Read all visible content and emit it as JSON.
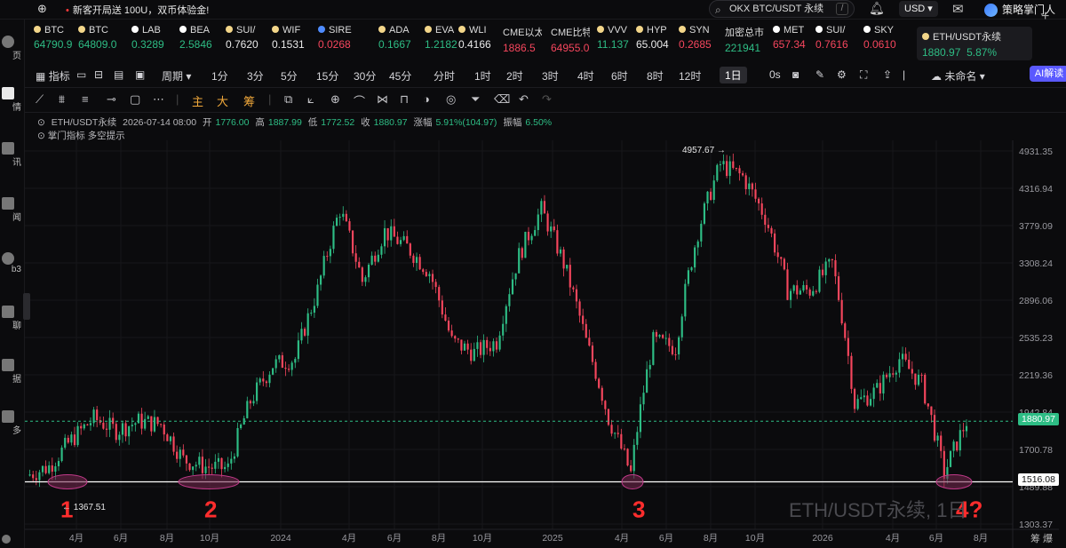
{
  "topbar": {
    "promo": "新客开局送 100U，双币体验金!",
    "search_value": "OKX BTC/USDT 永续",
    "search_shortcut": "/",
    "currency": "USD",
    "brand": "策略掌门人"
  },
  "leftnav": {
    "items": [
      {
        "label": "页"
      },
      {
        "label": "情"
      },
      {
        "label": "讯"
      },
      {
        "label": "闻"
      },
      {
        "label": "b3"
      },
      {
        "label": "聊"
      },
      {
        "label": "据"
      },
      {
        "label": "多"
      }
    ]
  },
  "tickers": [
    {
      "name": "BTC",
      "price": "64790.9",
      "dir": "up",
      "icon_color": "#f3d68a"
    },
    {
      "name": "BTC",
      "price": "64809.0",
      "dir": "up",
      "icon_color": "#f3d68a"
    },
    {
      "name": "LAB",
      "price": "0.3289",
      "dir": "up",
      "icon_color": "#ffffff"
    },
    {
      "name": "BEA",
      "price": "2.5846",
      "dir": "up",
      "icon_color": "#ffffff"
    },
    {
      "name": "SUI/",
      "price": "0.7620",
      "dir": "white",
      "icon_color": "#f3d68a"
    },
    {
      "name": "WIF",
      "price": "0.1531",
      "dir": "white",
      "icon_color": "#f3d68a"
    },
    {
      "name": "SIRE",
      "price": "0.0268",
      "dir": "down",
      "icon_color": "#4f8cff"
    },
    {
      "name": "ADA",
      "price": "0.1667",
      "dir": "up",
      "icon_color": "#f3d68a"
    },
    {
      "name": "EVA",
      "price": "1.2182",
      "dir": "up",
      "icon_color": "#f3d68a"
    },
    {
      "name": "WLI",
      "price": "0.4166",
      "dir": "white",
      "icon_color": "#f3d68a"
    },
    {
      "name": "CME以太",
      "price": "1886.5",
      "dir": "down",
      "icon_color": ""
    },
    {
      "name": "CME比特",
      "price": "64955.0",
      "dir": "down",
      "icon_color": ""
    },
    {
      "name": "VVV",
      "price": "11.137",
      "dir": "up",
      "icon_color": "#f3d68a"
    },
    {
      "name": "HYP",
      "price": "65.004",
      "dir": "white",
      "icon_color": "#f3d68a"
    },
    {
      "name": "SYN",
      "price": "0.2685",
      "dir": "down",
      "icon_color": "#f3d68a"
    },
    {
      "name": "加密总市",
      "price": "221941",
      "dir": "up",
      "icon_color": ""
    },
    {
      "name": "MET",
      "price": "657.34",
      "dir": "down",
      "icon_color": "#ffffff"
    },
    {
      "name": "SUI/",
      "price": "0.7616",
      "dir": "down",
      "icon_color": "#ffffff"
    },
    {
      "name": "SKY",
      "price": "0.0610",
      "dir": "down",
      "icon_color": "#ffffff"
    }
  ],
  "selected_ticker": {
    "name": "ETH/USDT永续",
    "price": "1880.97",
    "change": "5.87%"
  },
  "intervals": {
    "indicator": "指标",
    "period": "周期",
    "items": [
      "1分",
      "3分",
      "5分",
      "15分",
      "30分",
      "45分",
      "分时",
      "1时",
      "2时",
      "3时",
      "4时",
      "6时",
      "8时",
      "12时",
      "1日"
    ],
    "selected": "1日",
    "zoom": "0s",
    "layout_name": "未命名",
    "ai": "AI解读"
  },
  "drawbar": {
    "main": "主",
    "big": "大",
    "chip": "筹"
  },
  "info": {
    "symbol": "ETH/USDT永续",
    "datetime": "2026-07-14 08:00",
    "open_label": "开",
    "open": "1776.00",
    "high_label": "高",
    "high": "1887.99",
    "low_label": "低",
    "low": "1772.52",
    "close_label": "收",
    "close": "1880.97",
    "change_label": "涨幅",
    "change": "5.91%(104.97)",
    "amp_label": "振幅",
    "amp": "6.50%",
    "indicator_line": "掌门指标  多空提示"
  },
  "colors": {
    "up": "#2ebd85",
    "down": "#f6465d",
    "accent": "#5a59ff",
    "annotation": "#ff2d2d"
  },
  "chart_data": {
    "type": "candlestick",
    "y_ticks": [
      "4931.35",
      "4316.94",
      "3779.09",
      "3308.24",
      "2896.06",
      "2535.23",
      "2219.36",
      "1942.84",
      "1700.78",
      "1489.88",
      "1303.37"
    ],
    "x_ticks": [
      "4月",
      "6月",
      "8月",
      "10月",
      "2024",
      "4月",
      "6月",
      "8月",
      "10月",
      "2025",
      "4月",
      "6月",
      "8月",
      "10月",
      "2026",
      "4月",
      "6月",
      "8月"
    ],
    "current_price": "1880.97",
    "support_price": "1516.08",
    "high_marker": "4957.67",
    "high_marker_arrow": "→",
    "low_marker": "1367.51",
    "low_marker_arrow": "←",
    "annotations": [
      "1",
      "2",
      "3",
      "4?"
    ],
    "watermark": "ETH/USDT永续, 1日",
    "corner": "筹  爆",
    "path": [
      {
        "t": "2023-01",
        "p": 1550
      },
      {
        "t": "2023-02",
        "p": 1600
      },
      {
        "t": "2023-03",
        "p": 1760
      },
      {
        "t": "2023-04",
        "p": 1900
      },
      {
        "t": "2023-05",
        "p": 1820
      },
      {
        "t": "2023-06",
        "p": 1880
      },
      {
        "t": "2023-07",
        "p": 1860
      },
      {
        "t": "2023-08",
        "p": 1640
      },
      {
        "t": "2023-09",
        "p": 1600
      },
      {
        "t": "2023-10",
        "p": 1590
      },
      {
        "t": "2023-11",
        "p": 2020
      },
      {
        "t": "2023-12",
        "p": 2300
      },
      {
        "t": "2024-01",
        "p": 2350
      },
      {
        "t": "2024-02",
        "p": 3000
      },
      {
        "t": "2024-03",
        "p": 4000
      },
      {
        "t": "2024-04",
        "p": 3100
      },
      {
        "t": "2024-05",
        "p": 3700
      },
      {
        "t": "2024-06",
        "p": 3500
      },
      {
        "t": "2024-07",
        "p": 3200
      },
      {
        "t": "2024-08",
        "p": 2500
      },
      {
        "t": "2024-09",
        "p": 2400
      },
      {
        "t": "2024-10",
        "p": 2500
      },
      {
        "t": "2024-11",
        "p": 3400
      },
      {
        "t": "2024-12",
        "p": 4000
      },
      {
        "t": "2025-01",
        "p": 3300
      },
      {
        "t": "2025-02",
        "p": 2500
      },
      {
        "t": "2025-03",
        "p": 1900
      },
      {
        "t": "2025-04",
        "p": 1560
      },
      {
        "t": "2025-05",
        "p": 2500
      },
      {
        "t": "2025-06",
        "p": 2450
      },
      {
        "t": "2025-07",
        "p": 3700
      },
      {
        "t": "2025-08",
        "p": 4700
      },
      {
        "t": "2025-09",
        "p": 4500
      },
      {
        "t": "2025-10",
        "p": 3900
      },
      {
        "t": "2025-11",
        "p": 3000
      },
      {
        "t": "2025-12",
        "p": 3000
      },
      {
        "t": "2026-01",
        "p": 3300
      },
      {
        "t": "2026-02",
        "p": 2000
      },
      {
        "t": "2026-03",
        "p": 2100
      },
      {
        "t": "2026-04",
        "p": 2350
      },
      {
        "t": "2026-05",
        "p": 2150
      },
      {
        "t": "2026-06",
        "p": 1560
      },
      {
        "t": "2026-07",
        "p": 1880
      }
    ]
  }
}
